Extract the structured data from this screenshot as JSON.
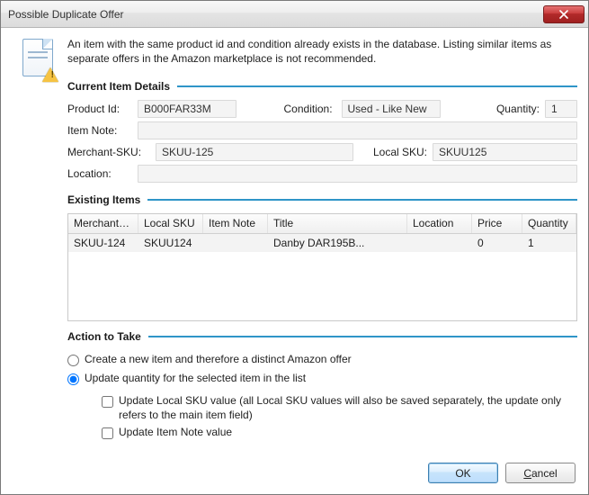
{
  "window": {
    "title": "Possible Duplicate Offer"
  },
  "intro": "An item with the same product id and condition already exists in the database. Listing similar items as separate offers in the Amazon marketplace is not recommended.",
  "sections": {
    "current": "Current Item Details",
    "existing": "Existing Items",
    "action": "Action to Take"
  },
  "labels": {
    "product_id": "Product Id:",
    "condition": "Condition:",
    "quantity": "Quantity:",
    "item_note": "Item Note:",
    "merchant_sku": "Merchant-SKU:",
    "local_sku": "Local SKU:",
    "location": "Location:"
  },
  "current": {
    "product_id": "B000FAR33M",
    "condition": "Used - Like New",
    "quantity": "1",
    "item_note": "",
    "merchant_sku": "SKUU-125",
    "local_sku": "SKUU125",
    "location": ""
  },
  "table": {
    "headers": {
      "merchant_sku": "Merchant-SKU",
      "local_sku": "Local SKU",
      "item_note": "Item Note",
      "title": "Title",
      "location": "Location",
      "price": "Price",
      "quantity": "Quantity"
    },
    "rows": [
      {
        "merchant_sku": "SKUU-124",
        "local_sku": "SKUU124",
        "item_note": "",
        "title": "Danby DAR195B...",
        "location": "",
        "price": "0",
        "quantity": "1"
      }
    ]
  },
  "actions": {
    "create": "Create a new item and therefore a distinct Amazon offer",
    "update": "Update quantity for the selected item in the list",
    "update_local_sku": "Update Local SKU value (all Local SKU values will also be saved separately, the update only refers to the main item field)",
    "update_item_note": "Update Item Note value"
  },
  "buttons": {
    "ok": "OK",
    "cancel_pre": "C",
    "cancel_post": "ancel"
  }
}
